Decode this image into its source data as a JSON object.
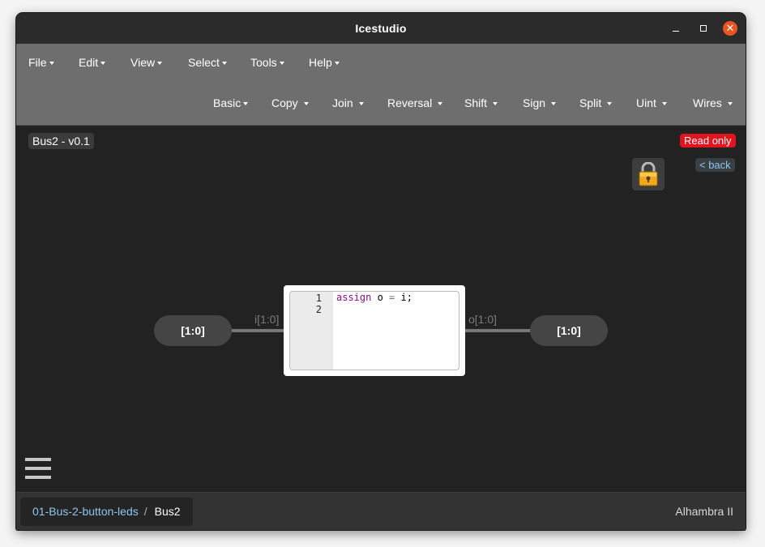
{
  "window": {
    "title": "Icestudio",
    "close_glyph": "✕"
  },
  "menu": {
    "main": [
      {
        "label": "File"
      },
      {
        "label": "Edit"
      },
      {
        "label": "View"
      },
      {
        "label": "Select"
      },
      {
        "label": "Tools"
      },
      {
        "label": "Help"
      }
    ],
    "blocks": [
      {
        "label": "Basic"
      },
      {
        "label": "Copy"
      },
      {
        "label": "Join"
      },
      {
        "label": "Reversal"
      },
      {
        "label": "Shift"
      },
      {
        "label": "Sign"
      },
      {
        "label": "Split"
      },
      {
        "label": "Uint"
      },
      {
        "label": "Wires"
      }
    ]
  },
  "canvas": {
    "version_badge": "Bus2 - v0.1",
    "readonly_badge": "Read only",
    "back_link": "< back",
    "lock_icon": "lock-icon",
    "input_port": {
      "text": "[1:0]",
      "label": "i[1:0]"
    },
    "output_port": {
      "text": "[1:0]",
      "label": "o[1:0]"
    },
    "code": {
      "line_numbers": [
        "1",
        "2"
      ],
      "line1": {
        "keyword": "assign",
        "lhs": " o ",
        "op": "=",
        "rhs": " i;"
      }
    }
  },
  "footer": {
    "breadcrumb_link": "01-Bus-2-button-leds",
    "breadcrumb_separator": "/",
    "breadcrumb_current": "Bus2",
    "board": "Alhambra II"
  },
  "colors": {
    "canvas_bg": "#222222",
    "menubar_bg": "#6e6e6e",
    "readonly_bg": "#e3141e",
    "link": "#8ec5ef",
    "close_button": "#e95420"
  }
}
